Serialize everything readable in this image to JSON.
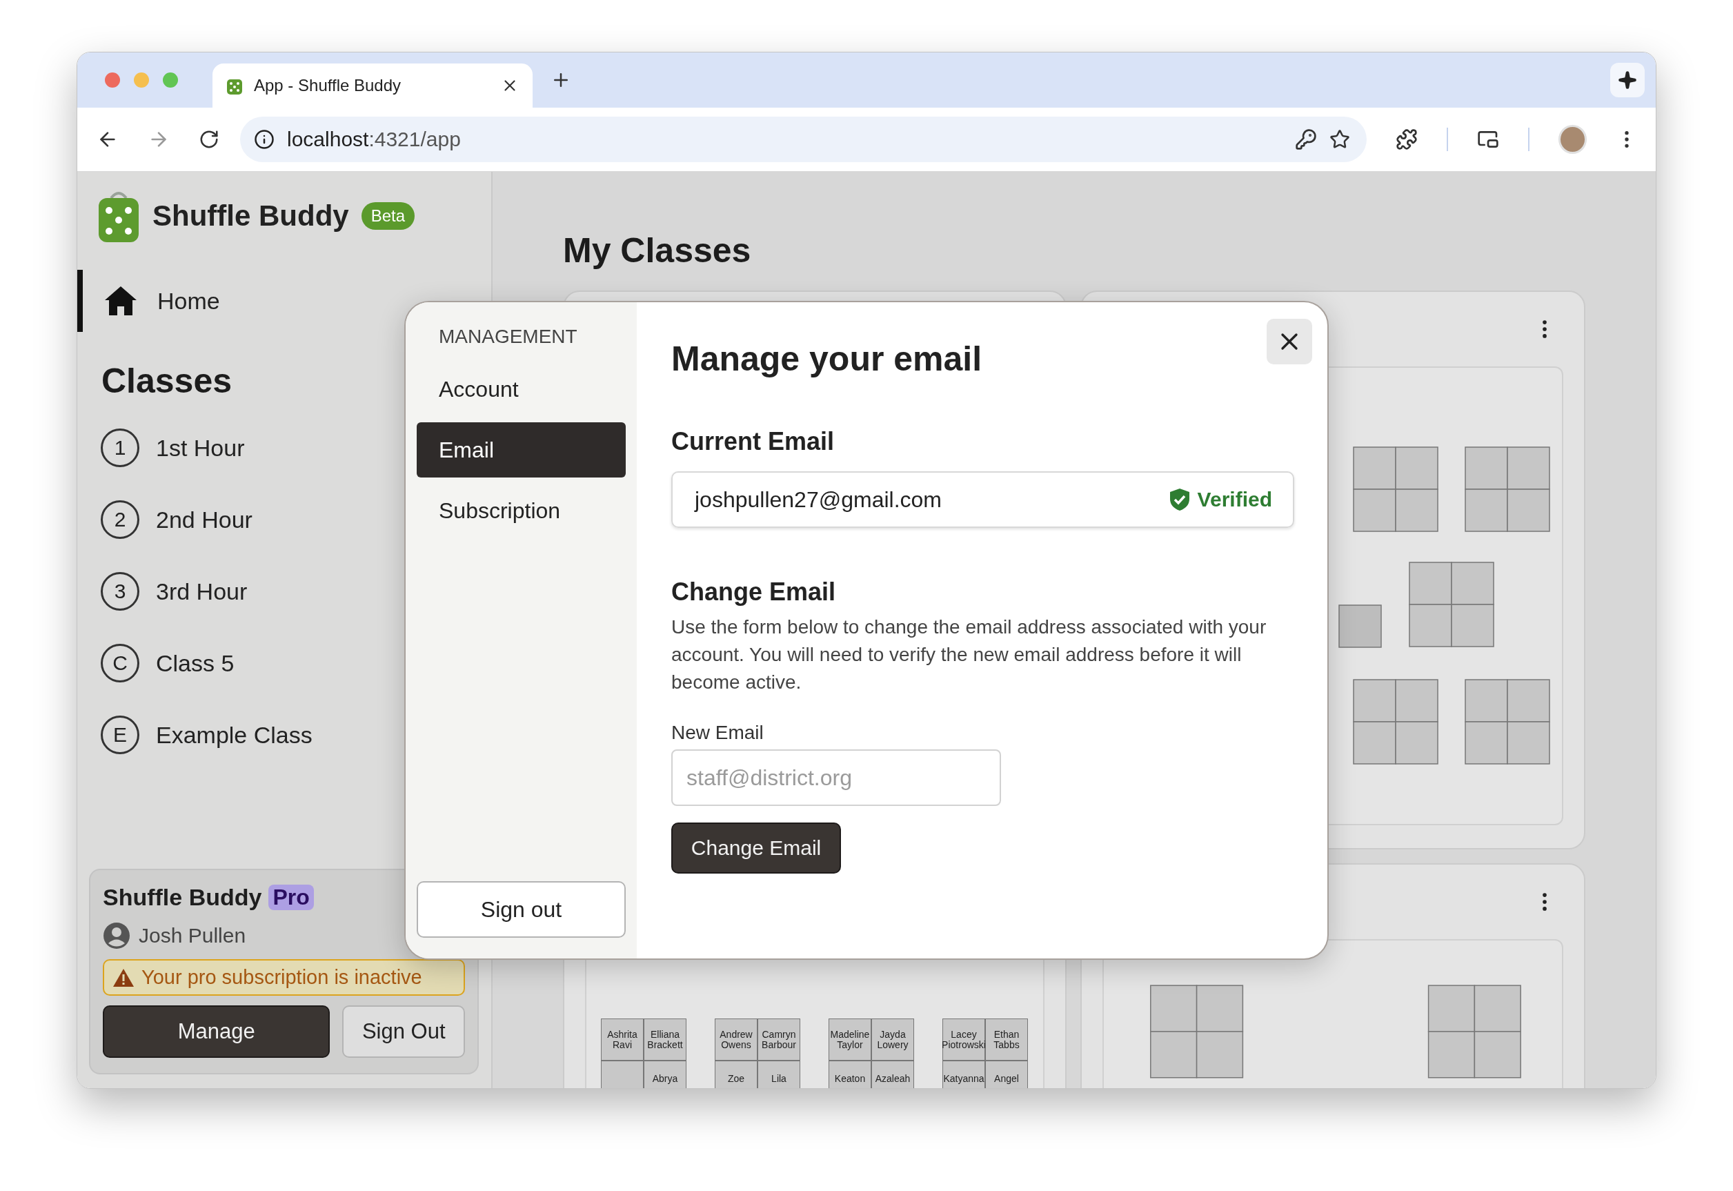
{
  "browser": {
    "tab_title": "App - Shuffle Buddy",
    "url_host": "localhost",
    "url_path": ":4321/app"
  },
  "sidebar": {
    "app_name": "Shuffle Buddy",
    "badge": "Beta",
    "nav": [
      {
        "label": "Home",
        "selected": true
      }
    ],
    "classes_heading": "Classes",
    "classes": [
      {
        "marker": "1",
        "label": "1st Hour"
      },
      {
        "marker": "2",
        "label": "2nd Hour"
      },
      {
        "marker": "3",
        "label": "3rd Hour"
      },
      {
        "marker": "C",
        "label": "Class 5"
      },
      {
        "marker": "E",
        "label": "Example Class"
      }
    ],
    "pro_card": {
      "title": "Shuffle Buddy",
      "badge": "Pro",
      "user": "Josh Pullen",
      "warning": "Your pro subscription is inactive",
      "buttons": [
        "Manage",
        "Sign Out"
      ]
    }
  },
  "main": {
    "title": "My Classes",
    "cards": [
      {
        "kind": "covered"
      },
      {
        "kind": "blank-seating"
      },
      {
        "kind": "seating",
        "groups": [
          {
            "seats": [
              {
                "kind": "student",
                "first": "Ashrita",
                "last": "Ravi"
              },
              {
                "kind": "student",
                "first": "Elliana",
                "last": "Brackett"
              },
              {
                "kind": "empty"
              },
              {
                "kind": "student",
                "first": "Abrya"
              }
            ]
          },
          {
            "seats": [
              {
                "kind": "student",
                "first": "Andrew",
                "last": "Owens"
              },
              {
                "kind": "student",
                "first": "Camryn",
                "last": "Barbour"
              },
              {
                "kind": "student",
                "first": "Zoe"
              },
              {
                "kind": "student",
                "first": "Lila"
              }
            ]
          },
          {
            "seats": [
              {
                "kind": "student",
                "first": "Madeline",
                "last": "Taylor"
              },
              {
                "kind": "student",
                "first": "Jayda",
                "last": "Lowery"
              },
              {
                "kind": "student",
                "first": "Keaton"
              },
              {
                "kind": "student",
                "first": "Azaleah"
              }
            ]
          },
          {
            "seats": [
              {
                "kind": "student",
                "first": "Lacey",
                "last": "Piotrowski"
              },
              {
                "kind": "student",
                "first": "Ethan",
                "last": "Tabbs"
              },
              {
                "kind": "student",
                "first": "Katyanna"
              },
              {
                "kind": "student",
                "first": "Angel"
              }
            ]
          }
        ]
      },
      {
        "kind": "blank-seating"
      }
    ]
  },
  "modal": {
    "nav_heading": "MANAGEMENT",
    "nav": [
      {
        "label": "Account",
        "selected": false
      },
      {
        "label": "Email",
        "selected": true
      },
      {
        "label": "Subscription",
        "selected": false
      }
    ],
    "sign_out": "Sign out",
    "title": "Manage your email",
    "current_email": {
      "label": "Current Email",
      "value": "joshpullen27@gmail.com",
      "status": "Verified",
      "verified": true
    },
    "change_email": {
      "heading": "Change Email",
      "description": "Use the form below to change the email address associated with your account. You will need to verify the new email address before it will become active.",
      "field_label": "New Email",
      "placeholder": "staff@district.org",
      "button": "Change Email"
    }
  }
}
